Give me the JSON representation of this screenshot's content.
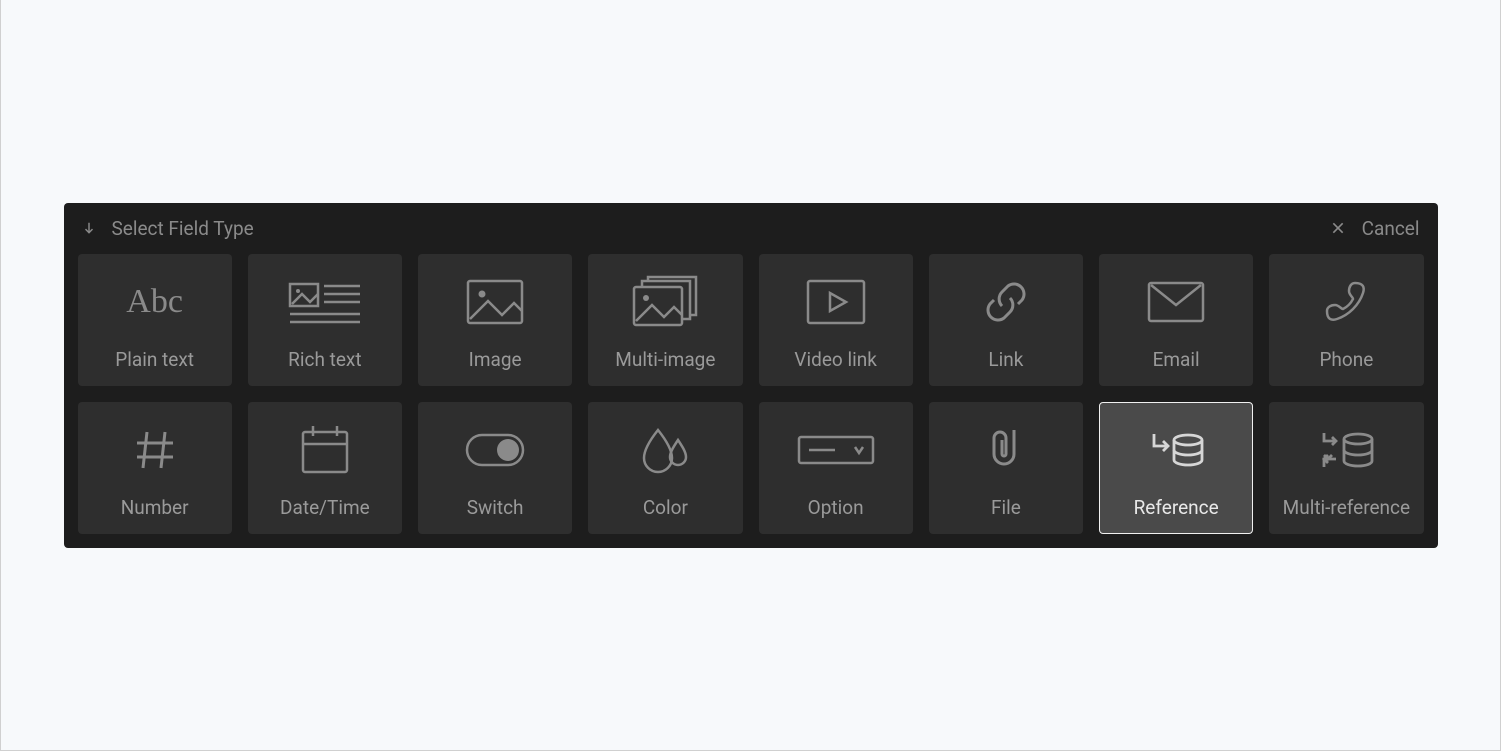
{
  "header": {
    "title": "Select Field Type",
    "cancel": "Cancel"
  },
  "fieldTypes": [
    {
      "id": "plain-text",
      "label": "Plain text",
      "icon": "abc",
      "selected": false
    },
    {
      "id": "rich-text",
      "label": "Rich text",
      "icon": "richtext",
      "selected": false
    },
    {
      "id": "image",
      "label": "Image",
      "icon": "image",
      "selected": false
    },
    {
      "id": "multi-image",
      "label": "Multi-image",
      "icon": "multi-image",
      "selected": false
    },
    {
      "id": "video-link",
      "label": "Video link",
      "icon": "video",
      "selected": false
    },
    {
      "id": "link",
      "label": "Link",
      "icon": "link",
      "selected": false
    },
    {
      "id": "email",
      "label": "Email",
      "icon": "email",
      "selected": false
    },
    {
      "id": "phone",
      "label": "Phone",
      "icon": "phone",
      "selected": false
    },
    {
      "id": "number",
      "label": "Number",
      "icon": "hash",
      "selected": false
    },
    {
      "id": "date-time",
      "label": "Date/Time",
      "icon": "calendar",
      "selected": false
    },
    {
      "id": "switch",
      "label": "Switch",
      "icon": "switch",
      "selected": false
    },
    {
      "id": "color",
      "label": "Color",
      "icon": "color",
      "selected": false
    },
    {
      "id": "option",
      "label": "Option",
      "icon": "option",
      "selected": false
    },
    {
      "id": "file",
      "label": "File",
      "icon": "file",
      "selected": false
    },
    {
      "id": "reference",
      "label": "Reference",
      "icon": "reference",
      "selected": true
    },
    {
      "id": "multi-reference",
      "label": "Multi-reference",
      "icon": "multi-reference",
      "selected": false
    }
  ]
}
